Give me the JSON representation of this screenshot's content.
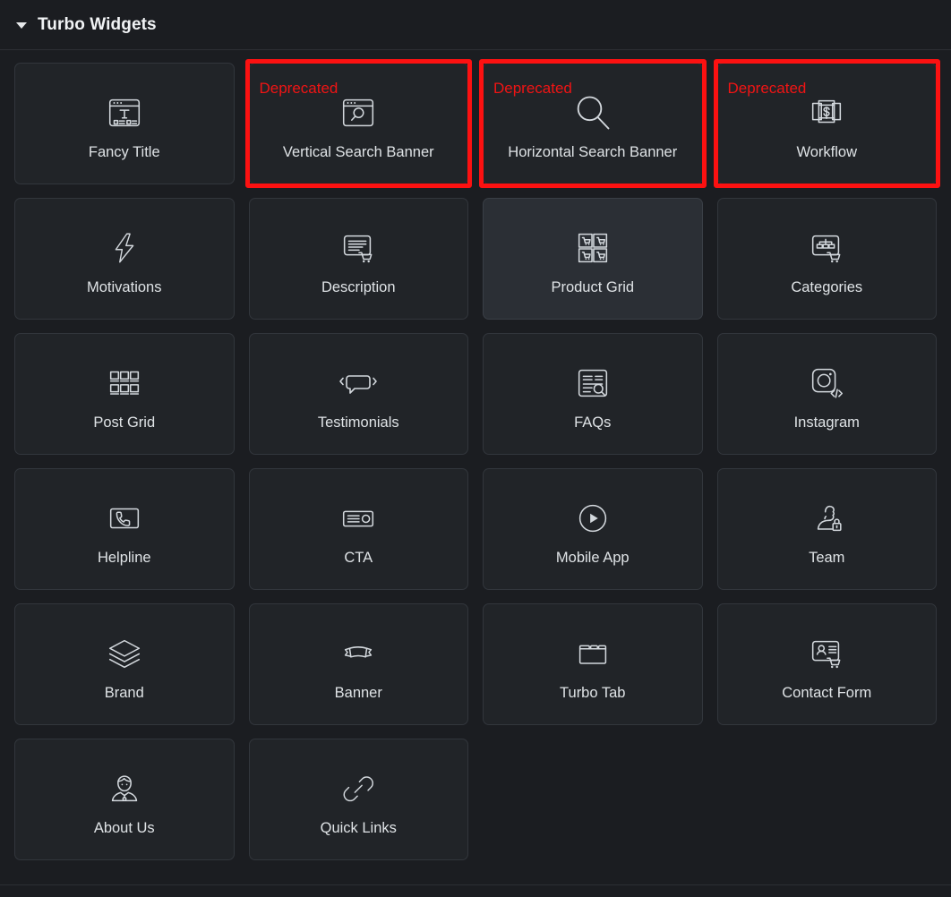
{
  "panel": {
    "title": "Turbo Widgets",
    "collapse_icon": "chevron-down-icon",
    "expanded": true
  },
  "colors": {
    "background": "#1b1d21",
    "card_background": "#212428",
    "card_hover_background": "#2b2f35",
    "card_border": "#32363c",
    "label_text": "#dfe3e6",
    "title_text": "#f1f3f5",
    "deprecated_accent": "#fc1111"
  },
  "badges": {
    "deprecated": "Deprecated"
  },
  "grid": {
    "columns": 4,
    "rows": 6,
    "widgets": [
      {
        "label": "Fancy Title",
        "icon": "window-text-title-icon",
        "deprecated": false,
        "hovered": false
      },
      {
        "label": "Vertical Search Banner",
        "icon": "window-search-icon",
        "deprecated": true,
        "hovered": false
      },
      {
        "label": "Horizontal Search Banner",
        "icon": "magnifier-icon",
        "deprecated": true,
        "hovered": false
      },
      {
        "label": "Workflow",
        "icon": "cards-dollar-icon",
        "deprecated": true,
        "hovered": false
      },
      {
        "label": "Motivations",
        "icon": "lightning-bolt-icon",
        "deprecated": false,
        "hovered": false
      },
      {
        "label": "Description",
        "icon": "text-card-cart-icon",
        "deprecated": false,
        "hovered": false
      },
      {
        "label": "Product Grid",
        "icon": "cart-grid-icon",
        "deprecated": false,
        "hovered": true
      },
      {
        "label": "Categories",
        "icon": "categories-cart-icon",
        "deprecated": false,
        "hovered": false
      },
      {
        "label": "Post Grid",
        "icon": "post-grid-icon",
        "deprecated": false,
        "hovered": false
      },
      {
        "label": "Testimonials",
        "icon": "speech-bubble-arrows-icon",
        "deprecated": false,
        "hovered": false
      },
      {
        "label": "FAQs",
        "icon": "document-search-icon",
        "deprecated": false,
        "hovered": false
      },
      {
        "label": "Instagram",
        "icon": "instagram-code-icon",
        "deprecated": false,
        "hovered": false
      },
      {
        "label": "Helpline",
        "icon": "phone-card-icon",
        "deprecated": false,
        "hovered": false
      },
      {
        "label": "CTA",
        "icon": "cta-banner-icon",
        "deprecated": false,
        "hovered": false
      },
      {
        "label": "Mobile App",
        "icon": "play-circle-icon",
        "deprecated": false,
        "hovered": false
      },
      {
        "label": "Team",
        "icon": "person-lock-icon",
        "deprecated": false,
        "hovered": false
      },
      {
        "label": "Brand",
        "icon": "layers-stack-icon",
        "deprecated": false,
        "hovered": false
      },
      {
        "label": "Banner",
        "icon": "ribbon-banner-icon",
        "deprecated": false,
        "hovered": false
      },
      {
        "label": "Turbo Tab",
        "icon": "folder-tabs-icon",
        "deprecated": false,
        "hovered": false
      },
      {
        "label": "Contact Form",
        "icon": "contact-card-cart-icon",
        "deprecated": false,
        "hovered": false
      },
      {
        "label": "About Us",
        "icon": "person-suit-icon",
        "deprecated": false,
        "hovered": false
      },
      {
        "label": "Quick Links",
        "icon": "chain-link-icon",
        "deprecated": false,
        "hovered": false
      }
    ]
  }
}
